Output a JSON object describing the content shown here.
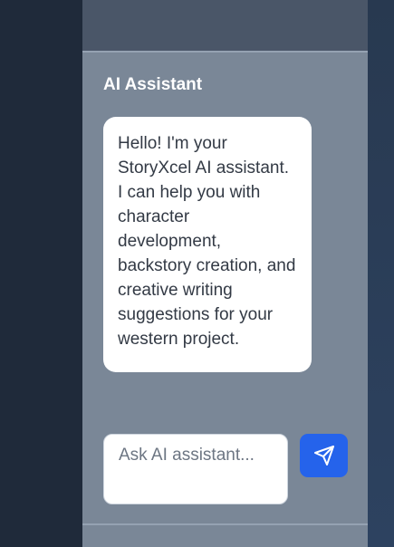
{
  "assistant": {
    "title": "AI Assistant",
    "message": "Hello! I'm your StoryXcel AI assistant. I can help you with character development, backstory creation, and creative writing suggestions for your western project."
  },
  "input": {
    "placeholder": "Ask AI assistant...",
    "value": ""
  },
  "send_button": {
    "icon": "send-icon",
    "color": "#2563eb"
  }
}
